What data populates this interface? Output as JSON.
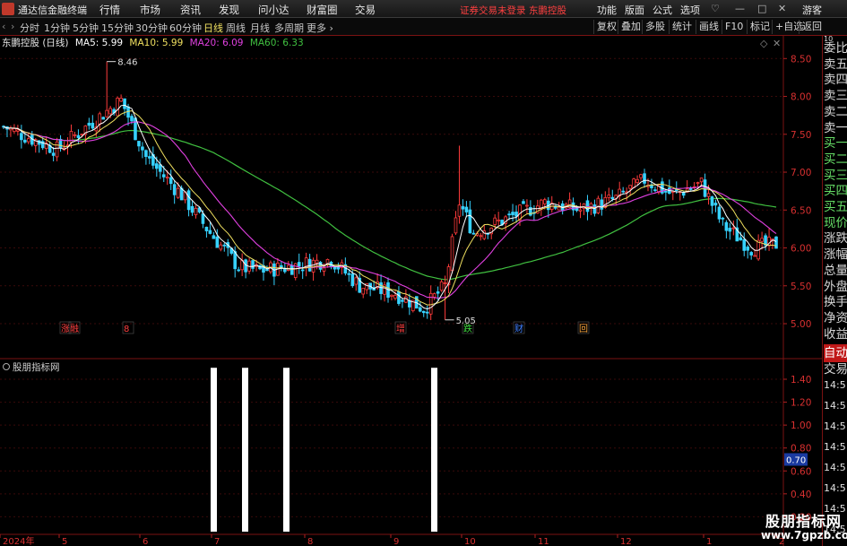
{
  "window": {
    "title": "通达信金融终端",
    "minimize": "—",
    "restore": "□",
    "close": "✕",
    "pin": "♡"
  },
  "menu": [
    "行情",
    "市场",
    "资讯",
    "发现",
    "问小达",
    "财富圈",
    "交易"
  ],
  "notice": {
    "login": "证券交易未登录",
    "stock": "东鹏控股"
  },
  "right_menu": [
    "功能",
    "版面",
    "公式",
    "选项",
    "游客"
  ],
  "period_tabs": [
    "分时",
    "1分钟",
    "5分钟",
    "15分钟",
    "30分钟",
    "60分钟",
    "日线",
    "周线",
    "月线",
    "多周期",
    "更多"
  ],
  "active_period": "日线",
  "toolbar_buttons": [
    "复权",
    "叠加",
    "多股",
    "统计",
    "画线",
    "F10",
    "标记",
    "+自选",
    "返回"
  ],
  "info": {
    "stock_label": "东鹏控股 (日线)",
    "ma5": "MA5: 5.99",
    "ma10": "MA10: 5.99",
    "ma20": "MA20: 6.09",
    "ma60": "MA60: 6.33"
  },
  "main_chart": {
    "y_labels": [
      "8.50",
      "8.00",
      "7.50",
      "7.00",
      "6.50",
      "6.00",
      "5.50",
      "5.00"
    ],
    "ylim": [
      4.87,
      8.61
    ],
    "high_label": "8.46",
    "low_label": "5.05",
    "colors": {
      "up": "#ff3b3b",
      "down": "#36d2ff",
      "ma5": "#ffffff",
      "ma10": "#f0e060",
      "ma20": "#e040e0",
      "ma60": "#40c040"
    }
  },
  "event_markers": [
    {
      "text": "涨",
      "color": "#ff4040"
    },
    {
      "text": "融",
      "color": "#ff4040"
    },
    {
      "text": "8",
      "color": "#ff4040"
    },
    {
      "text": "增",
      "color": "#ff4040"
    },
    {
      "text": "跌",
      "color": "#40dd40"
    },
    {
      "text": "财",
      "color": "#4080ff"
    },
    {
      "text": "回",
      "color": "#ffaa40"
    }
  ],
  "sub_chart": {
    "title": "股朋指标网",
    "y_labels": [
      "1.40",
      "1.20",
      "1.00",
      "0.80",
      "0.60",
      "0.40",
      "0.20"
    ],
    "ylim": [
      0.07,
      1.58
    ],
    "current_value": "0.70",
    "bars": [
      {
        "value": 1.5
      },
      {
        "value": 1.5
      },
      {
        "value": 1.5
      },
      {
        "value": 1.5
      }
    ]
  },
  "date_axis": [
    "2024年",
    "5",
    "6",
    "7",
    "8",
    "9",
    "10",
    "11",
    "12",
    "1",
    "2"
  ],
  "right_panel": {
    "items": [
      "委比",
      "卖五",
      "卖四",
      "卖三",
      "卖二",
      "卖一",
      "买一",
      "买二",
      "买三",
      "买四",
      "买五",
      "现价",
      "涨跌",
      "涨幅",
      "总量",
      "外盘",
      "换手",
      "净资",
      "收益"
    ],
    "tabs": [
      "自动",
      "交易"
    ],
    "times": [
      "14:5",
      "14:5",
      "14:5",
      "14:5",
      "14:5",
      "14:5",
      "14:5",
      "14:5",
      "14:5"
    ],
    "top": "10"
  },
  "watermark": {
    "title": "股朋指标网",
    "url": "www.7gpzb.com"
  }
}
